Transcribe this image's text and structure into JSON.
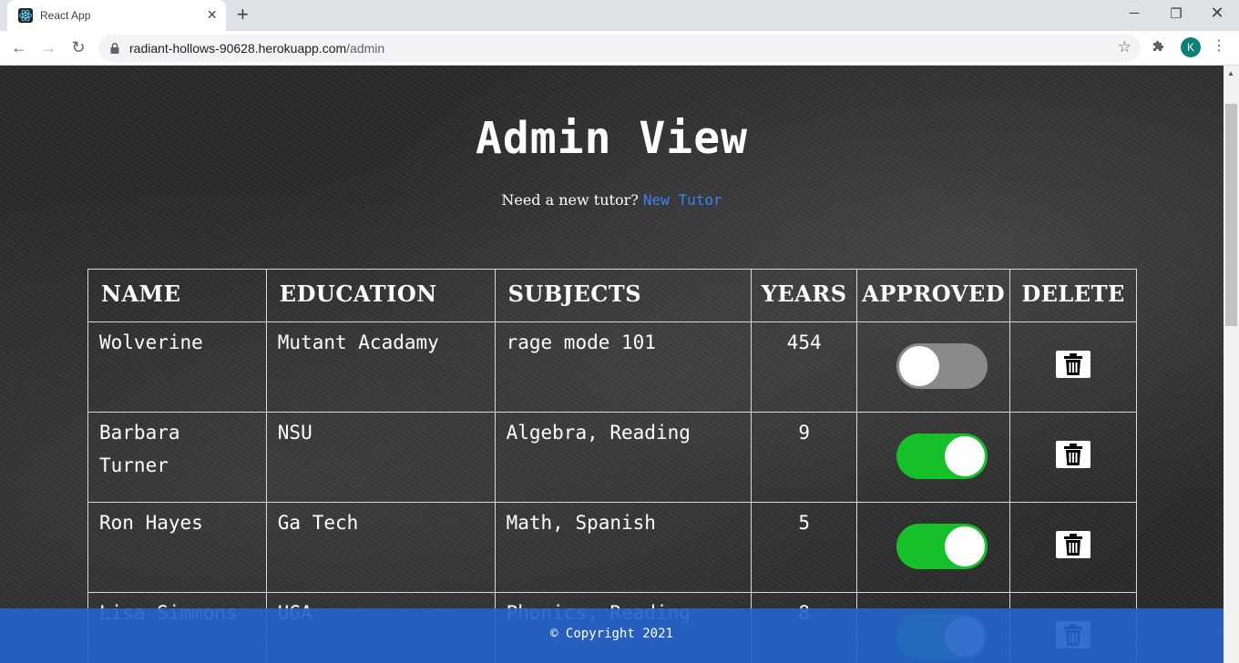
{
  "browser": {
    "tab_title": "React App",
    "url_host": "radiant-hollows-90628.herokuapp.com",
    "url_path": "/admin",
    "profile_initial": "K"
  },
  "page": {
    "title": "Admin View",
    "subtitle_prefix": "Need a new tutor?",
    "new_tutor_link": "New Tutor",
    "footer": "© Copyright 2021"
  },
  "table": {
    "headers": [
      "NAME",
      "EDUCATION",
      "SUBJECTS",
      "YEARS",
      "APPROVED",
      "DELETE"
    ],
    "rows": [
      {
        "name": "Wolverine",
        "education": "Mutant Acadamy",
        "subjects": "rage mode 101",
        "years": "454",
        "approved": false
      },
      {
        "name": "Barbara Turner",
        "education": "NSU",
        "subjects": "Algebra, Reading",
        "years": "9",
        "approved": true
      },
      {
        "name": "Ron Hayes",
        "education": "Ga Tech",
        "subjects": "Math, Spanish",
        "years": "5",
        "approved": true
      },
      {
        "name": "Lisa Simmons",
        "education": "UGA",
        "subjects": "Phonics, Reading",
        "years": "8",
        "approved": true
      }
    ]
  },
  "colors": {
    "toggle_on": "#16c02a",
    "toggle_off": "#8a8a8a",
    "link": "#3b82f6",
    "footer": "#2563c9"
  },
  "icons": {
    "favicon": "react-icon",
    "delete": "trash-icon"
  }
}
